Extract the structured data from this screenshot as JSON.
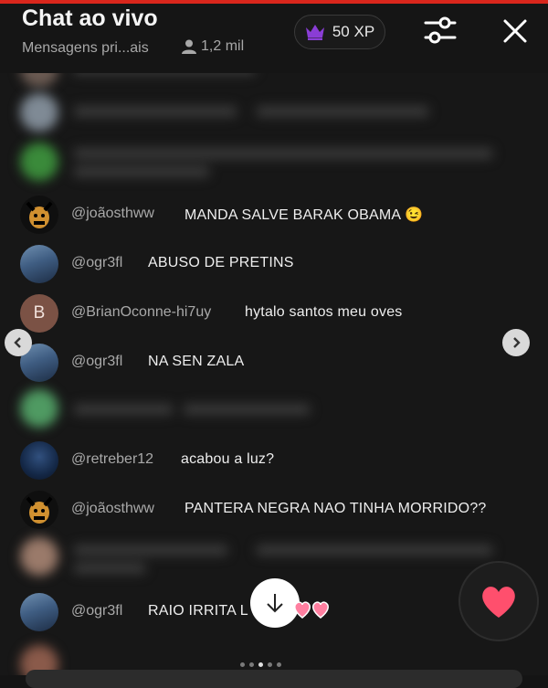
{
  "header": {
    "title": "Chat ao vivo",
    "subtitle": "Mensagens pri...ais",
    "viewer_count": "1,2 mil",
    "xp_label": "50 XP"
  },
  "messages": [
    {
      "user": "@joãosthww",
      "text": "MANDA SALVE BARAK OBAMA 😉"
    },
    {
      "user": "@ogr3fl",
      "text": "ABUSO DE PRETINS"
    },
    {
      "user": "@BrianOconne-hi7uy",
      "text": "hytalo santos meu oves",
      "avatar_letter": "B"
    },
    {
      "user": "@ogr3fl",
      "text": "NA SEN ZALA"
    },
    {
      "user": "@retreber12",
      "text": "acabou a luz?"
    },
    {
      "user": "@joãosthww",
      "text": "PANTERA NEGRA NAO TINHA MORRIDO??"
    },
    {
      "user": "@ogr3fl",
      "text": "RAIO IRRITA L"
    }
  ],
  "colors": {
    "accent_red": "#d9261c",
    "badge_purple": "#8a3dd6",
    "heart_pink": "#ff4f6d"
  },
  "icons": {
    "xp_badge": "crown-icon",
    "viewers": "person-icon",
    "filter": "sliders-icon",
    "close": "close-icon",
    "prev": "chevron-left-icon",
    "next": "chevron-right-icon",
    "scroll": "arrow-down-icon",
    "reaction": "heart-icon"
  }
}
